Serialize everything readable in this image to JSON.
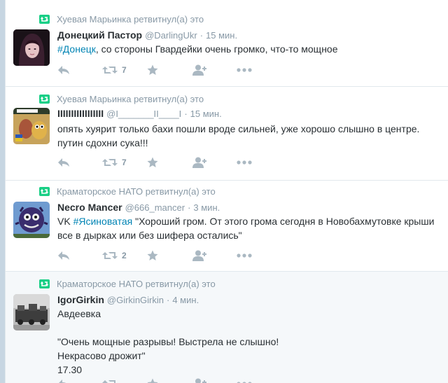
{
  "colors": {
    "background": "#e1e8ed",
    "card": "#ffffff",
    "card_highlight": "#f5f8fa",
    "retweet_green": "#19cf86",
    "action_gray": "#aab8c2",
    "meta_gray": "#8899a6",
    "link_blue": "#0084b4",
    "text": "#292f33"
  },
  "icons": {
    "retweet": "retweet-icon",
    "reply": "reply-icon",
    "favorite": "star-icon",
    "follow": "follow-user-icon",
    "more": "more-dots-icon"
  },
  "tweets": [
    {
      "retweeter": "Хуевая Марьинка ретвитнул(а) это",
      "fullname": "Донецкий Пастор",
      "username": "@DarlingUkr",
      "sep": "·",
      "time": "15 мин.",
      "hashtag": "#Донецк",
      "text": ", со стороны Гвардейки очень громко,  что-то мощное",
      "retweet_count": "7"
    },
    {
      "retweeter": "Хуевая Марьинка ретвитнул(а) это",
      "fullname": "IIIIIIIIIIIIIIIII",
      "username": "@I_______II____I",
      "sep": "·",
      "time": "15 мин.",
      "text": "опять хуярит только бахи пошли вроде сильней, уже хорошо слышно в центре.\nпутин сдохни сука!!!",
      "retweet_count": "7"
    },
    {
      "retweeter": "Краматорское НАТО ретвитнул(а) это",
      "fullname": "Necro Mancer",
      "username": "@666_mancer",
      "sep": "·",
      "time": "3 мин.",
      "prefix": "VK ",
      "hashtag": "#Ясиноватая",
      "text": " \"Хороший гром. От этого грома сегодня в Новобахмутовке крыши все в дырках или без шифера остались\"",
      "retweet_count": "2"
    },
    {
      "retweeter": "Краматорское НАТО ретвитнул(а) это",
      "fullname": "IgorGirkin",
      "username": "@GirkinGirkin",
      "sep": "·",
      "time": "4 мин.",
      "text": "Авдеевка\n\n\"Очень мощные разрывы! Выстрела не слышно!\nНекрасово дрожит\"\n17.30"
    }
  ]
}
